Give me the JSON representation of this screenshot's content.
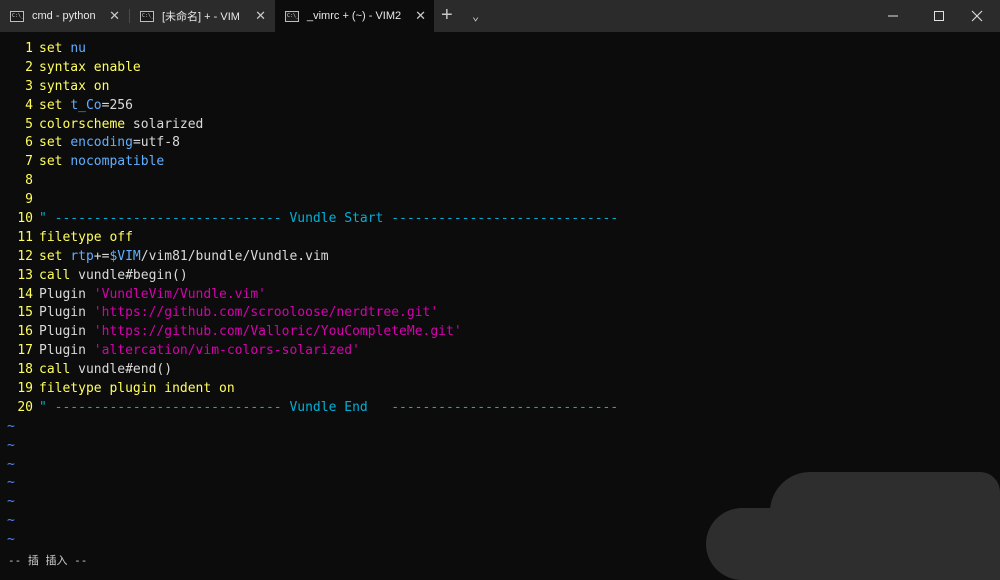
{
  "tabs": [
    {
      "title": "cmd - python",
      "icon_text": "C:\\_",
      "close": "✕"
    },
    {
      "title": "[未命名] + - VIM",
      "icon_text": "C:\\_",
      "close": "✕"
    },
    {
      "title": "_vimrc + (~) - VIM2",
      "icon_text": "C:\\_",
      "close": "✕"
    }
  ],
  "new_tab_label": "+",
  "dropdown_label": "⌄",
  "window_controls": {
    "minimize": "minimize-icon",
    "maximize": "maximize-icon",
    "close": "close-icon"
  },
  "lines": [
    {
      "n": "1",
      "parts": [
        {
          "t": "set",
          "c": "kw"
        },
        {
          "t": " "
        },
        {
          "t": "nu",
          "c": "opt"
        }
      ]
    },
    {
      "n": "2",
      "parts": [
        {
          "t": "syntax",
          "c": "kw"
        },
        {
          "t": " "
        },
        {
          "t": "enable",
          "c": "kw"
        }
      ]
    },
    {
      "n": "3",
      "parts": [
        {
          "t": "syntax",
          "c": "kw"
        },
        {
          "t": " "
        },
        {
          "t": "on",
          "c": "kw"
        }
      ]
    },
    {
      "n": "4",
      "parts": [
        {
          "t": "set",
          "c": "kw"
        },
        {
          "t": " "
        },
        {
          "t": "t_Co",
          "c": "opt"
        },
        {
          "t": "=256",
          "c": "nm"
        }
      ]
    },
    {
      "n": "5",
      "parts": [
        {
          "t": "colorscheme",
          "c": "kw"
        },
        {
          "t": " solarized",
          "c": "nm"
        }
      ]
    },
    {
      "n": "6",
      "parts": [
        {
          "t": "set",
          "c": "kw"
        },
        {
          "t": " "
        },
        {
          "t": "encoding",
          "c": "opt"
        },
        {
          "t": "=utf-8",
          "c": "nm"
        }
      ]
    },
    {
      "n": "7",
      "parts": [
        {
          "t": "set",
          "c": "kw"
        },
        {
          "t": " "
        },
        {
          "t": "nocompatible",
          "c": "opt"
        }
      ]
    },
    {
      "n": "8",
      "parts": []
    },
    {
      "n": "9",
      "parts": []
    },
    {
      "n": "10",
      "parts": [
        {
          "t": "\" ----------------------------- Vundle Start -----------------------------",
          "c": "cmt"
        }
      ]
    },
    {
      "n": "11",
      "parts": [
        {
          "t": "filetype",
          "c": "kw"
        },
        {
          "t": " "
        },
        {
          "t": "off",
          "c": "kw"
        }
      ]
    },
    {
      "n": "12",
      "parts": [
        {
          "t": "set",
          "c": "kw"
        },
        {
          "t": " "
        },
        {
          "t": "rtp",
          "c": "opt"
        },
        {
          "t": "+=",
          "c": "nm"
        },
        {
          "t": "$VIM",
          "c": "opt"
        },
        {
          "t": "/vim81/bundle/Vundle.vim",
          "c": "nm"
        }
      ]
    },
    {
      "n": "13",
      "parts": [
        {
          "t": "call",
          "c": "kw"
        },
        {
          "t": " vundle#begin()",
          "c": "nm"
        }
      ]
    },
    {
      "n": "14",
      "parts": [
        {
          "t": "Plugin ",
          "c": "nm"
        },
        {
          "t": "'VundleVim/Vundle.vim'",
          "c": "str"
        }
      ]
    },
    {
      "n": "15",
      "parts": [
        {
          "t": "Plugin ",
          "c": "nm"
        },
        {
          "t": "'https://github.com/scrooloose/nerdtree.git'",
          "c": "str"
        }
      ]
    },
    {
      "n": "16",
      "parts": [
        {
          "t": "Plugin ",
          "c": "nm"
        },
        {
          "t": "'https://github.com/Valloric/YouCompleteMe.git'",
          "c": "str"
        }
      ]
    },
    {
      "n": "17",
      "parts": [
        {
          "t": "Plugin ",
          "c": "nm"
        },
        {
          "t": "'altercation/vim-colors-solarized'",
          "c": "str"
        }
      ]
    },
    {
      "n": "18",
      "parts": [
        {
          "t": "call",
          "c": "kw"
        },
        {
          "t": " vundle#end()",
          "c": "nm"
        }
      ]
    },
    {
      "n": "19",
      "parts": [
        {
          "t": "filetype",
          "c": "kw"
        },
        {
          "t": " "
        },
        {
          "t": "plugin",
          "c": "kw"
        },
        {
          "t": " "
        },
        {
          "t": "indent",
          "c": "kw"
        },
        {
          "t": " "
        },
        {
          "t": "on",
          "c": "kw"
        }
      ]
    },
    {
      "n": "20",
      "parts": [
        {
          "t": "\" ----------------------------- Vundle End   -----------------------------",
          "c": "cmt"
        }
      ]
    }
  ],
  "tildes": [
    "~",
    "~",
    "~",
    "~",
    "~",
    "~",
    "~"
  ],
  "status": "-- 插 插入 --"
}
